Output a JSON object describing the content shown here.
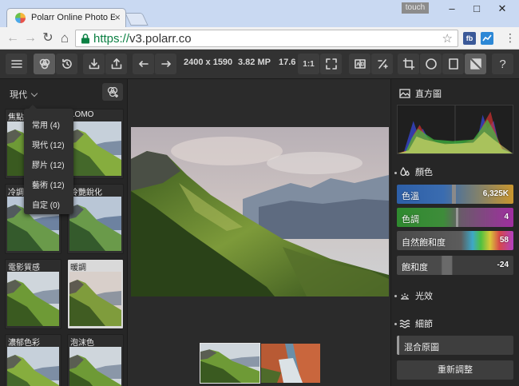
{
  "browser": {
    "tab_title": "Polarr Online Photo Edit",
    "tab_close": "×",
    "touch_label": "touch",
    "url_protocol": "https://",
    "url_host": "v3.polarr.co",
    "star": "☆",
    "ext_fb": "fb",
    "minimize": "–",
    "maximize": "□",
    "close": "✕",
    "back": "←",
    "forward": "→",
    "reload": "↻",
    "home": "⌂",
    "menu": "⋮"
  },
  "toolbar": {
    "resolution": "2400 x 1590",
    "megapixels": "3.82 MP",
    "zoom": "17.6",
    "ratio_label": "1:1"
  },
  "left_panel": {
    "category": "現代",
    "filters": [
      {
        "name": "焦點"
      },
      {
        "name": "LOMO"
      },
      {
        "name": "冷調"
      },
      {
        "name": "冷艷銳化"
      },
      {
        "name": "電影質感"
      },
      {
        "name": "暖調"
      },
      {
        "name": "濃郁色彩"
      },
      {
        "name": "泡沫色"
      }
    ],
    "dropdown": [
      {
        "label": "常用 (4)"
      },
      {
        "label": "現代 (12)"
      },
      {
        "label": "膠片 (12)"
      },
      {
        "label": "藝術 (12)"
      },
      {
        "label": "自定 (0)"
      }
    ]
  },
  "right_panel": {
    "histogram_title": "直方圖",
    "color_section": "顏色",
    "sliders": [
      {
        "label": "色溫",
        "value": "6,325K"
      },
      {
        "label": "色調",
        "value": "4"
      },
      {
        "label": "自然飽和度",
        "value": "58"
      },
      {
        "label": "飽和度",
        "value": "-24"
      }
    ],
    "light_section": "光效",
    "detail_section": "細節",
    "blend_button": "混合原圖",
    "reset_button": "重新調整"
  }
}
